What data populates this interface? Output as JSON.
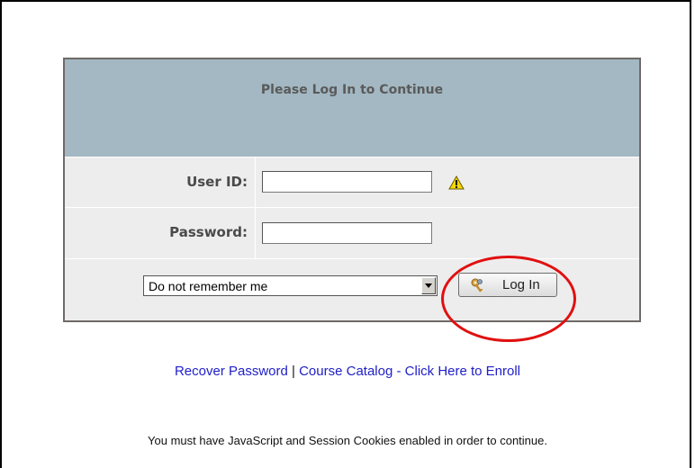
{
  "login": {
    "title": "Please Log In to Continue",
    "user_id_label": "User ID:",
    "user_id_value": "",
    "password_label": "Password:",
    "password_value": "",
    "remember_selected": "Do not remember me",
    "login_button_label": "Log In"
  },
  "icons": {
    "warning": "warning-icon",
    "key": "key-icon",
    "dropdown": "chevron-down-icon"
  },
  "links": {
    "recover_password": "Recover Password",
    "separator": "|",
    "course_catalog": "Course Catalog - Click Here to Enroll"
  },
  "notice": "You must have JavaScript and Session Cookies enabled in order to continue.",
  "colors": {
    "header_bg": "#a3b8c2",
    "row_bg": "#ededed",
    "link": "#2020c8",
    "highlight": "#e01010"
  }
}
